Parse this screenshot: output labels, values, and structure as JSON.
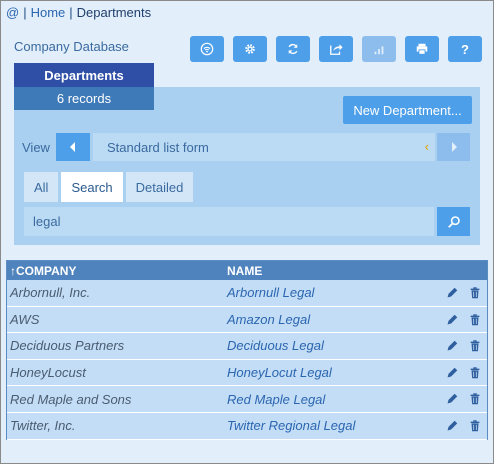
{
  "breadcrumb": {
    "at": "@",
    "home": "Home",
    "current": "Departments"
  },
  "db_title": "Company Database",
  "toolbar": {
    "buttons": [
      {
        "icon": "wifi-icon"
      },
      {
        "icon": "gear-icon"
      },
      {
        "icon": "refresh-icon"
      },
      {
        "icon": "export-icon"
      },
      {
        "icon": "chart-icon",
        "disabled": true
      },
      {
        "icon": "printer-icon"
      },
      {
        "icon": "help-icon",
        "label": "?"
      }
    ]
  },
  "departments": {
    "title": "Departments",
    "records": "6 records",
    "new_button": "New Department..."
  },
  "view": {
    "label": "View",
    "selected": "Standard list form"
  },
  "tabs": [
    "All",
    "Search",
    "Detailed"
  ],
  "active_tab": "Search",
  "search": {
    "value": "legal"
  },
  "table": {
    "headers": {
      "company": "↑COMPANY",
      "name": "NAME"
    },
    "rows": [
      {
        "company": "Arbornull, Inc.",
        "name": "Arbornull Legal"
      },
      {
        "company": "AWS",
        "name": "Amazon Legal"
      },
      {
        "company": "Deciduous Partners",
        "name": "Deciduous Legal"
      },
      {
        "company": "HoneyLocust",
        "name": "HoneyLocut Legal"
      },
      {
        "company": "Red Maple and Sons",
        "name": "Red Maple Legal"
      },
      {
        "company": "Twitter, Inc.",
        "name": "Twitter Regional Legal"
      }
    ]
  },
  "colors": {
    "accent": "#4d9fea",
    "dept_header": "#2f4fa6",
    "table_header": "#4f83bd",
    "pending_chevron": "#e6a400"
  }
}
